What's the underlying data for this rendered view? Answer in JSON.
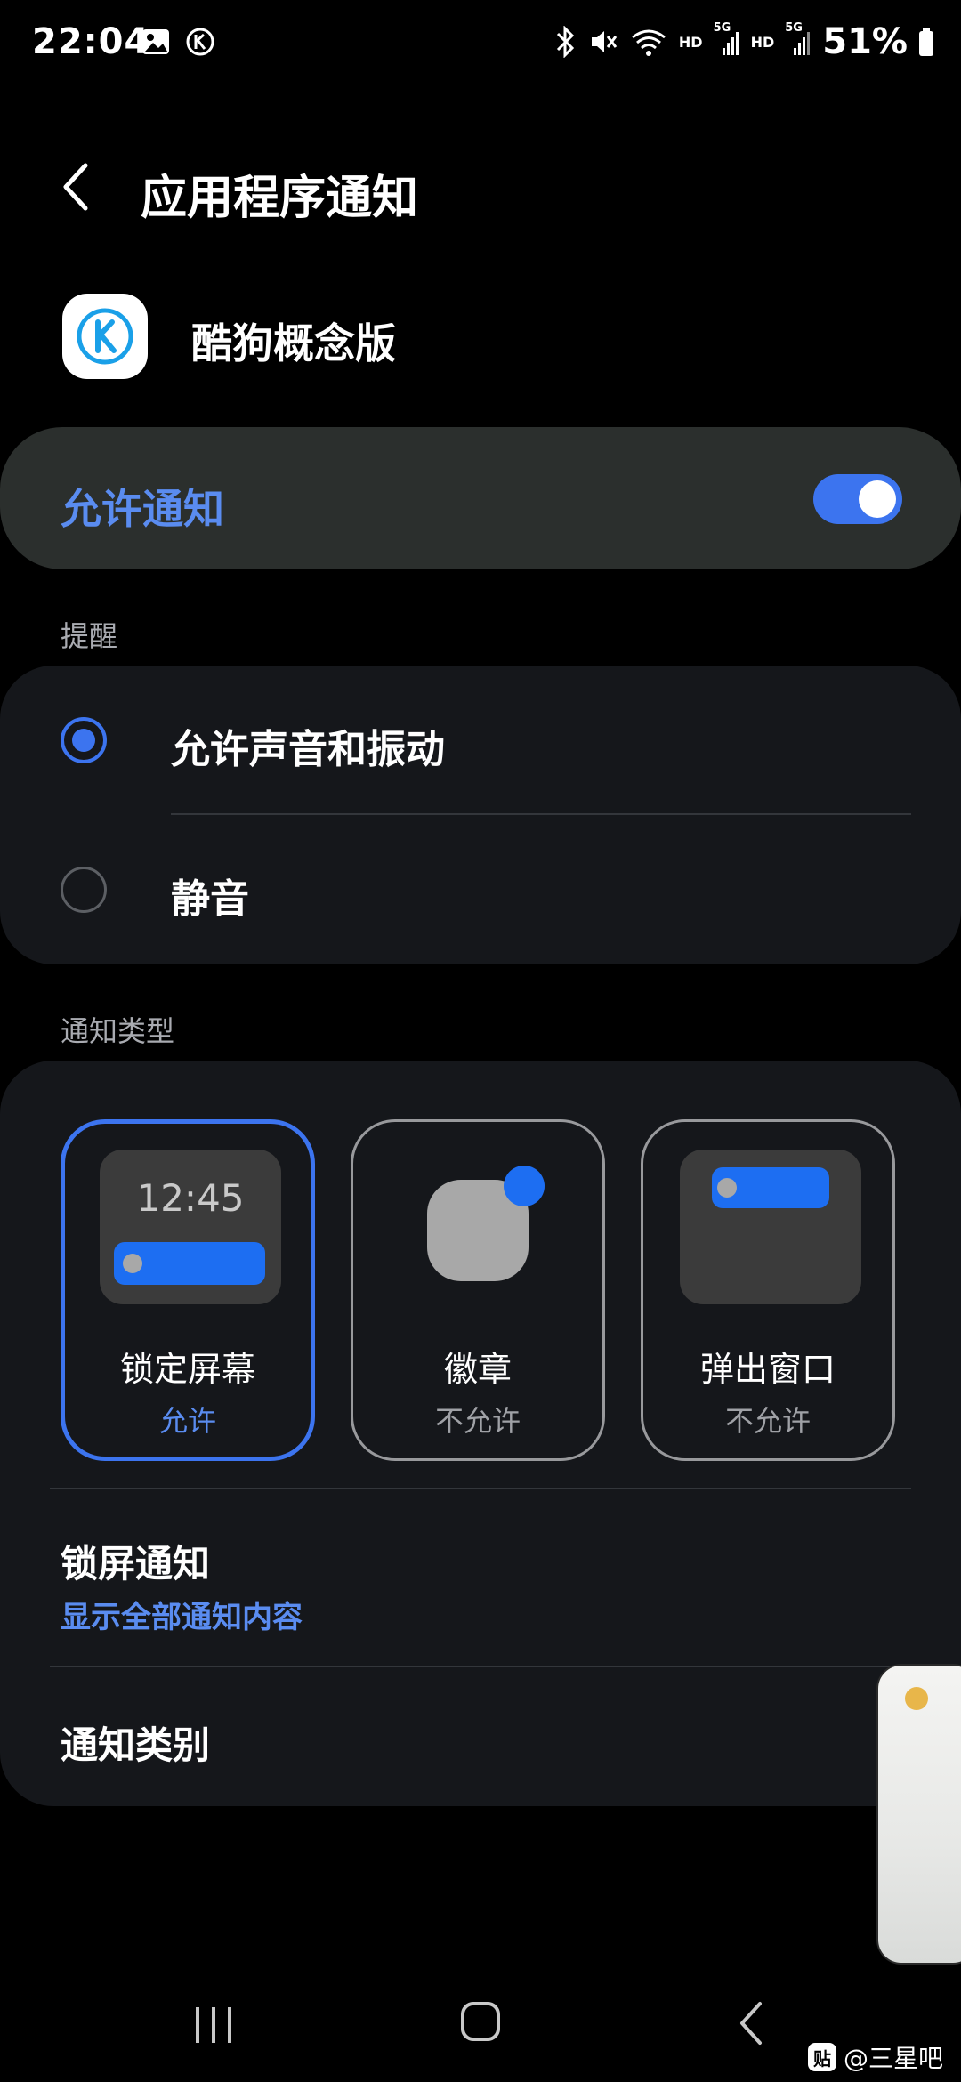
{
  "status_bar": {
    "time": "22:04",
    "hd_1": "HD",
    "fiveg_1": "5G",
    "hd_2": "HD",
    "fiveg_2": "5G",
    "battery": "51%"
  },
  "header": {
    "title": "应用程序通知",
    "app_name": "酷狗概念版",
    "app_icon_letter": "K"
  },
  "allow": {
    "label": "允许通知",
    "enabled": true
  },
  "reminder": {
    "section_label": "提醒",
    "options": [
      {
        "label": "允许声音和振动",
        "selected": true
      },
      {
        "label": "静音",
        "selected": false
      }
    ]
  },
  "notification_type": {
    "section_label": "通知类型",
    "tiles": [
      {
        "name": "锁定屏幕",
        "status": "允许",
        "preview_time": "12:45",
        "selected": true
      },
      {
        "name": "徽章",
        "status": "不允许",
        "selected": false
      },
      {
        "name": "弹出窗口",
        "status": "不允许",
        "selected": false
      }
    ]
  },
  "lock_screen": {
    "title": "锁屏通知",
    "value": "显示全部通知内容"
  },
  "categories": {
    "title": "通知类别"
  },
  "watermark": {
    "box": "贴",
    "text": "@三星吧"
  },
  "colors": {
    "accent": "#3c74ef",
    "accent_text": "#5a8cf0",
    "card": "#15171b",
    "allow_card": "#2b2f2d",
    "background": "#000000"
  }
}
